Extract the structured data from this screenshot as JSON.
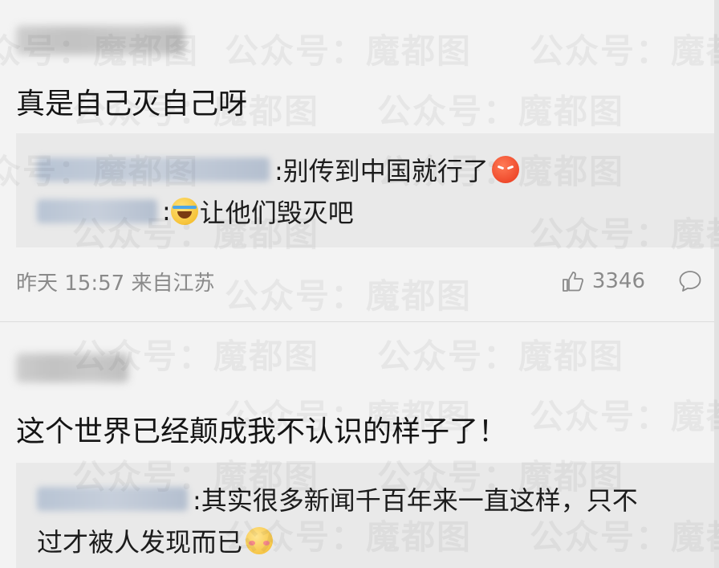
{
  "watermark": "公众号：魔都图",
  "comments": [
    {
      "text": "真是自己灭自己呀",
      "replies": [
        {
          "text": ":别传到中国就行了",
          "emoji": "angry-face-icon"
        },
        {
          "text": "让他们毁灭吧",
          "prefix": ":",
          "emoji": "laugh-cry-icon"
        }
      ],
      "meta": {
        "time": "昨天 15:57 来自江苏",
        "likes": "3346"
      }
    },
    {
      "text": "这个世界已经颠成我不认识的样子了！",
      "replies": [
        {
          "line1": ":其实很多新闻千百年来一直这样，只不",
          "line2": "过才被人发现而已",
          "emoji": "shy-face-icon"
        }
      ]
    }
  ],
  "colors": {
    "background": "#f3f3f3",
    "reply_background": "#e9e9e9",
    "meta_text": "#8a8a8a"
  }
}
